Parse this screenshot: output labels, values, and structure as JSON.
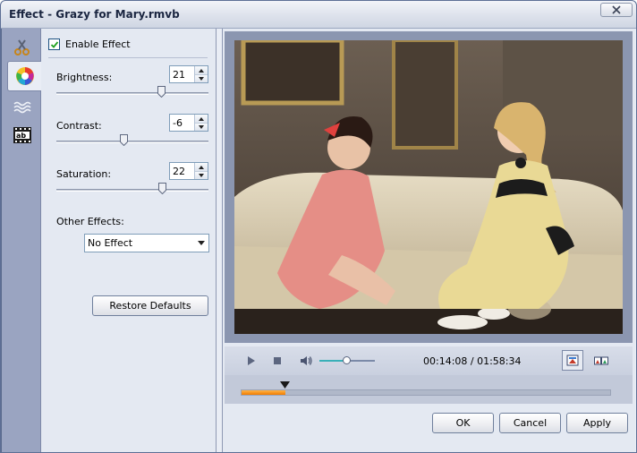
{
  "window": {
    "title": "Effect - Grazy for Mary.rmvb",
    "close_icon": "close-icon"
  },
  "tabs": [
    {
      "name": "clip",
      "icon": "scissors-icon",
      "active": false
    },
    {
      "name": "effect",
      "icon": "color-wheel-icon",
      "active": true
    },
    {
      "name": "watermark",
      "icon": "watermark-icon",
      "active": false
    },
    {
      "name": "subtitle",
      "icon": "text-ab-icon",
      "active": false
    }
  ],
  "effect": {
    "enable_label": "Enable Effect",
    "enable_checked": true,
    "brightness": {
      "label": "Brightness:",
      "value": "21",
      "level": 0.7
    },
    "contrast": {
      "label": "Contrast:",
      "value": "-6",
      "level": 0.44
    },
    "saturation": {
      "label": "Saturation:",
      "value": "22",
      "level": 0.71
    },
    "other_effects_label": "Other Effects:",
    "other_effects_value": "No Effect",
    "restore_label": "Restore Defaults"
  },
  "player": {
    "timecode": "00:14:08 / 01:58:34",
    "volume_level": 0.48,
    "progress": 0.12,
    "play_icon": "play-icon",
    "stop_icon": "stop-icon",
    "volume_icon": "volume-icon",
    "view_single_icon": "single-view-icon",
    "view_compare_icon": "compare-view-icon"
  },
  "buttons": {
    "ok": "OK",
    "cancel": "Cancel",
    "apply": "Apply"
  },
  "colors": {
    "accent": "#3ab0b8",
    "progress": "#f07d00",
    "frame": "#5a6a8c"
  }
}
